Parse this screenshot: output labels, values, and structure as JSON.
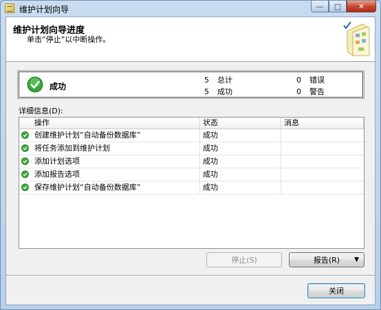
{
  "window": {
    "title": "维护计划向导",
    "minimize_glyph": "—",
    "maximize_glyph": "□",
    "close_glyph": "✕"
  },
  "header": {
    "title": "维护计划向导进度",
    "subtitle": "单击“停止”以中断操作。"
  },
  "summary": {
    "status": "成功",
    "total_count": "5",
    "total_label": "总计",
    "success_count": "5",
    "success_label": "成功",
    "error_count": "0",
    "error_label": "错误",
    "warning_count": "0",
    "warning_label": "警告"
  },
  "details": {
    "label": "详细信息(D):",
    "columns": [
      "操作",
      "状态",
      "消息"
    ],
    "rows": [
      {
        "action": "创建维护计划“自动备份数据库”",
        "status": "成功",
        "message": ""
      },
      {
        "action": "将任务添加到维护计划",
        "status": "成功",
        "message": ""
      },
      {
        "action": "添加计划选项",
        "status": "成功",
        "message": ""
      },
      {
        "action": "添加报告选项",
        "status": "成功",
        "message": ""
      },
      {
        "action": "保存维护计划“自动备份数据库”",
        "status": "成功",
        "message": ""
      }
    ]
  },
  "buttons": {
    "stop": "停止(S)",
    "report": "报告(R)",
    "report_arrow": "▼",
    "close": "关闭"
  },
  "colors": {
    "success_green": "#2f9b2f",
    "window_frame": "#b7cfe8"
  }
}
